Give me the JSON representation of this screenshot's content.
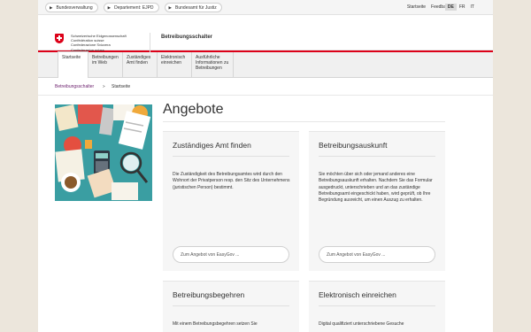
{
  "topbar": {
    "crumbs": [
      "Bundesverwaltung",
      "Departement: EJPD",
      "Bundesamt für Justiz"
    ],
    "links": [
      "Startseite",
      "Feedback"
    ],
    "languages": [
      {
        "label": "DE",
        "active": true
      },
      {
        "label": "FR",
        "active": false
      },
      {
        "label": "IT",
        "active": false
      }
    ]
  },
  "header": {
    "fed_lines": [
      "Schweizerische Eidgenossenschaft",
      "Confédération suisse",
      "Confederazione Svizzera",
      "Confederaziun svizra"
    ],
    "app_title": "Betreibungsschalter"
  },
  "nav": {
    "items": [
      {
        "label": "Startseite",
        "active": true
      },
      {
        "label": "Betreibungen im Web",
        "active": false
      },
      {
        "label": "Zuständiges Amt finden",
        "active": false
      },
      {
        "label": "Elektronisch einreichen",
        "active": false
      },
      {
        "label": "Ausführliche Informationen zu Betreibungen",
        "active": false
      }
    ]
  },
  "breadcrumb": {
    "parent": "Betreibungsschalter",
    "current": "Startseite"
  },
  "main": {
    "heading": "Angebote",
    "cards": [
      {
        "title": "Zuständiges Amt finden",
        "body": "Die Zuständigkeit des Betreibungsamtes wird durch den Wohnort der Privatperson resp. den Sitz des Unternehmens (juristischen Person) bestimmt.",
        "button": "Zum Angebot von EasyGov ..."
      },
      {
        "title": "Betreibungsauskunft",
        "body": "Sie möchten über sich oder jemand anderes eine Betreibungsauskunft erhalten. Nachdem Sie das Formular ausgedruckt, unterschrieben und an das zuständige Betreibungsamt eingeschickt haben, wird geprüft, ob Ihre Begründung ausreicht, um einen Auszug zu erhalten.",
        "button": "Zum Angebot von EasyGov ..."
      },
      {
        "title": "Betreibungsbegehren",
        "body": "Mit einem Betreibungsbegehren setzen Sie"
      },
      {
        "title": "Elektronisch einreichen",
        "body": "Digital qualifiziert unterschriebene Gesuche"
      }
    ]
  },
  "colors": {
    "swiss_red": "#dc0018",
    "link_purple": "#6a1d6b",
    "illustration_bg": "#3a9ea2",
    "card_bg": "#f6f6f6",
    "page_bg": "#ece6dc"
  }
}
